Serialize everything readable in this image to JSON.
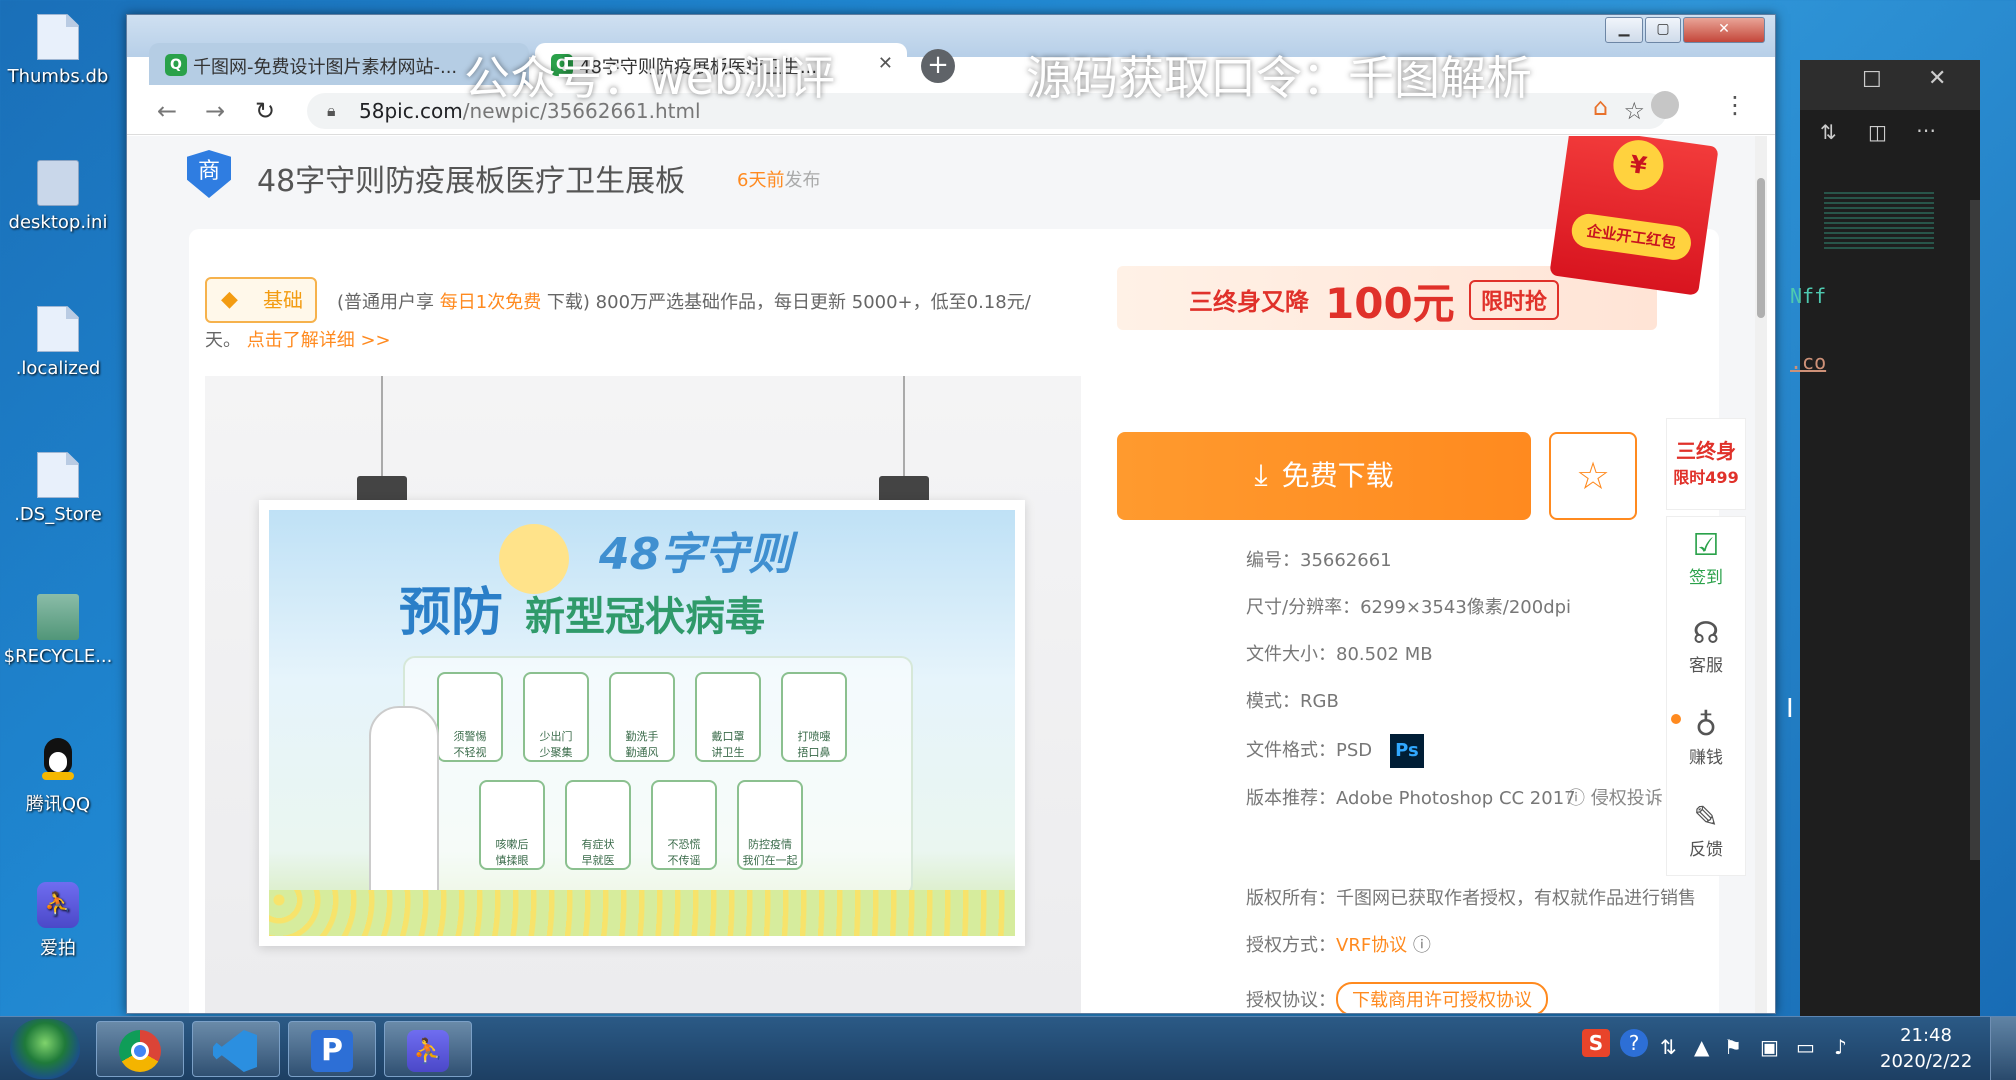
{
  "desktop": {
    "icons": [
      {
        "name": "Thumbs.db"
      },
      {
        "name": "desktop.ini"
      },
      {
        "name": ".localized"
      },
      {
        "name": ".DS_Store"
      },
      {
        "name": "$RECYCLE..."
      },
      {
        "name": "腾讯QQ"
      },
      {
        "name": "爱拍"
      }
    ]
  },
  "overlay": {
    "left": "公众号：web测评",
    "right": "源码获取口令：千图解析"
  },
  "browser": {
    "tabs": [
      {
        "label": "千图网-免费设计图片素材网站-..."
      },
      {
        "label": "48字守则防疫展板医疗卫生..."
      }
    ],
    "url_domain": "58pic.com",
    "url_path": "/newpic/35662661.html"
  },
  "page": {
    "badge": "商",
    "title": "48字守则防疫展板医疗卫生展板",
    "time": "6天前",
    "time_suffix": "发布",
    "basic_badge": "基础",
    "notice_a": "(普通用户享 ",
    "notice_b": "每日1次免费",
    "notice_c": " 下载) 800万严选基础作品，每日更新 5000+，低至0.18元/",
    "notice_d": "天。",
    "notice_link": "点击了解详细 >>",
    "promo": "三终身又降",
    "promo_amount": "100元",
    "promo_tag": "限时抢",
    "redpacket": "企业开工红包",
    "download_label": "免费下载",
    "meta": [
      {
        "k": "编号：",
        "v": "35662661"
      },
      {
        "k": "尺寸/分辨率：",
        "v": "6299×3543像素/200dpi"
      },
      {
        "k": "文件大小：",
        "v": "80.502 MB"
      },
      {
        "k": "模式：",
        "v": "RGB"
      },
      {
        "k": "文件格式：",
        "v": "PSD"
      },
      {
        "k": "版本推荐：",
        "v": "Adobe Photoshop CC 2017"
      }
    ],
    "report": "侵权投诉",
    "copyright_k": "版权所有：",
    "copyright_v": "千图网已获取作者授权，有权就作品进行销售",
    "license_k": "授权方式：",
    "license_v": "VRF协议",
    "agreement_k": "授权协议：",
    "agreement_v": "下载商用许可授权协议",
    "ps_label": "Ps",
    "side": {
      "promo_a": "三终身",
      "promo_b": "限时499",
      "items": [
        "签到",
        "客服",
        "赚钱",
        "反馈"
      ]
    },
    "poster": {
      "t1": "48字守则",
      "t2": "预防",
      "t3": "新型冠状病毒",
      "cells": [
        "须警惕\n不轻视",
        "少出门\n少聚集",
        "勤洗手\n勤通风",
        "戴口罩\n讲卫生",
        "打喷嚏\n捂口鼻",
        "咳嗽后\n慎揉眼",
        "有症状\n早就医",
        "不恐慌\n不传谣",
        "防控疫情\n我们在一起"
      ]
    }
  },
  "taskbar": {
    "time": "21:48",
    "date": "2020/2/22"
  },
  "colors": {
    "accent": "#ff8a1f",
    "brand_green": "#2aa14a",
    "desktop": "#1f86d0"
  }
}
